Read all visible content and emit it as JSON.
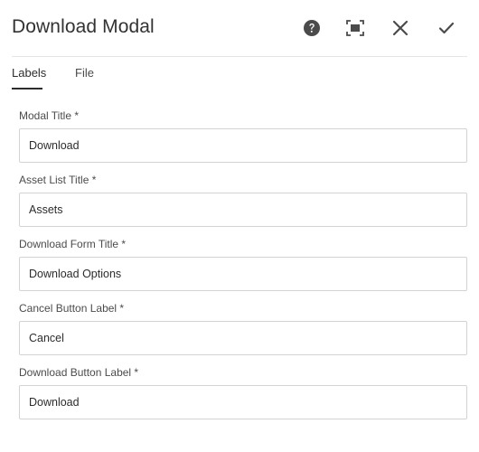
{
  "dialog": {
    "title": "Download Modal",
    "actions": [
      {
        "name": "help",
        "icon": "help-circle-icon"
      },
      {
        "name": "fullscreen",
        "icon": "fullscreen-icon"
      },
      {
        "name": "close",
        "icon": "close-icon"
      },
      {
        "name": "done",
        "icon": "checkmark-icon"
      }
    ]
  },
  "tabs": [
    {
      "label": "Labels",
      "selected": true
    },
    {
      "label": "File",
      "selected": false
    }
  ],
  "fields": [
    {
      "label": "Modal Title *",
      "value": "Download"
    },
    {
      "label": "Asset List Title *",
      "value": "Assets"
    },
    {
      "label": "Download Form Title *",
      "value": "Download Options"
    },
    {
      "label": "Cancel Button Label *",
      "value": "Cancel"
    },
    {
      "label": "Download Button Label *",
      "value": "Download"
    }
  ],
  "colors": {
    "text": "#323232",
    "icon": "#4b4b4b",
    "border": "#d3d3d3",
    "divider": "#e6e6e6"
  }
}
